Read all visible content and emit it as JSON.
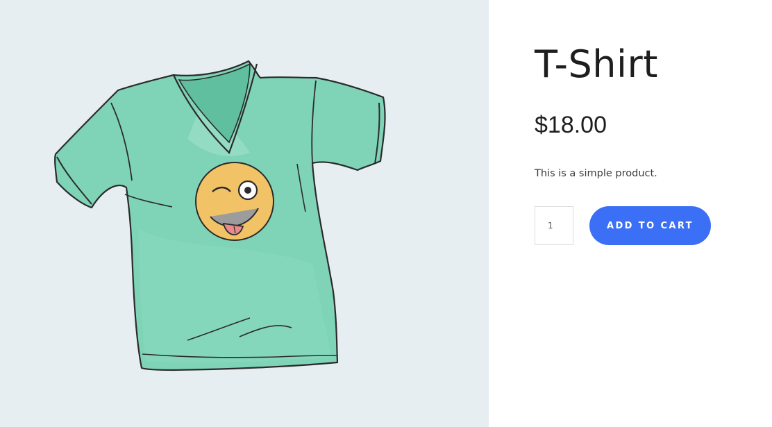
{
  "product": {
    "title": "T-Shirt",
    "price": "$18.00",
    "short_description": "This is a simple product.",
    "image_subject": "t-shirt-with-winking-emoji-illustration"
  },
  "cart": {
    "quantity": "1",
    "add_to_cart_label": "ADD TO CART"
  },
  "colors": {
    "gallery_background": "#e6eef2",
    "shirt": "#7fd3b6",
    "emoji": "#f2c267",
    "button": "#3b6ff5"
  }
}
